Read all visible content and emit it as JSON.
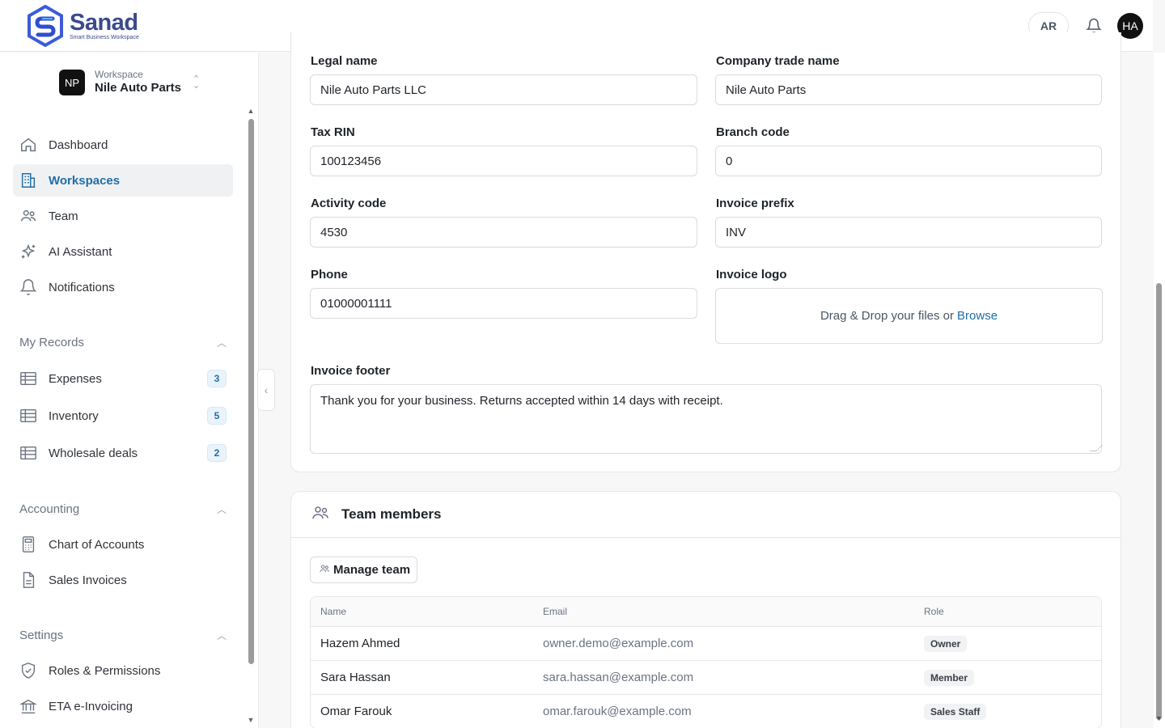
{
  "brand": {
    "name": "Sanad",
    "tagline": "Smart Business Workspace"
  },
  "header": {
    "language_button": "AR",
    "avatar_initials": "HA"
  },
  "workspace": {
    "label": "Workspace",
    "badge": "NP",
    "name": "Nile Auto Parts"
  },
  "nav": {
    "main": [
      {
        "label": "Dashboard",
        "icon": "home-icon"
      },
      {
        "label": "Workspaces",
        "icon": "building-icon",
        "active": true
      },
      {
        "label": "Team",
        "icon": "users-icon"
      },
      {
        "label": "AI Assistant",
        "icon": "sparkles-icon"
      },
      {
        "label": "Notifications",
        "icon": "bell-icon"
      }
    ],
    "my_records": {
      "title": "My Records",
      "items": [
        {
          "label": "Expenses",
          "count": "3"
        },
        {
          "label": "Inventory",
          "count": "5"
        },
        {
          "label": "Wholesale deals",
          "count": "2"
        }
      ]
    },
    "accounting": {
      "title": "Accounting",
      "items": [
        {
          "label": "Chart of Accounts"
        },
        {
          "label": "Sales Invoices"
        }
      ]
    },
    "settings": {
      "title": "Settings",
      "items": [
        {
          "label": "Roles & Permissions"
        },
        {
          "label": "ETA e-Invoicing"
        }
      ]
    }
  },
  "form": {
    "legal_name": {
      "label": "Legal name",
      "value": "Nile Auto Parts LLC"
    },
    "trade_name": {
      "label": "Company trade name",
      "value": "Nile Auto Parts"
    },
    "tax_rin": {
      "label": "Tax RIN",
      "value": "100123456"
    },
    "branch_code": {
      "label": "Branch code",
      "value": "0"
    },
    "activity_code": {
      "label": "Activity code",
      "value": "4530"
    },
    "invoice_prefix": {
      "label": "Invoice prefix",
      "value": "INV"
    },
    "phone": {
      "label": "Phone",
      "value": "01000001111"
    },
    "invoice_logo": {
      "label": "Invoice logo",
      "drop_text": "Drag & Drop your files or",
      "browse": "Browse"
    },
    "invoice_footer": {
      "label": "Invoice footer",
      "value": "Thank you for your business. Returns accepted within 14 days with receipt."
    }
  },
  "team": {
    "title": "Team members",
    "manage_button": "Manage team",
    "columns": {
      "name": "Name",
      "email": "Email",
      "role": "Role"
    },
    "rows": [
      {
        "name": "Hazem Ahmed",
        "email": "owner.demo@example.com",
        "role": "Owner"
      },
      {
        "name": "Sara Hassan",
        "email": "sara.hassan@example.com",
        "role": "Member"
      },
      {
        "name": "Omar Farouk",
        "email": "omar.farouk@example.com",
        "role": "Sales Staff"
      }
    ]
  }
}
